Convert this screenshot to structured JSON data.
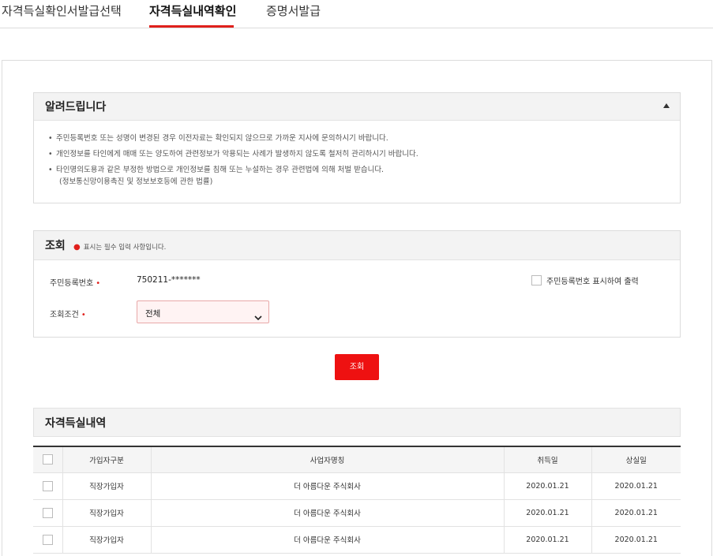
{
  "tabs": [
    {
      "label": "자격득실확인서발급선택"
    },
    {
      "label": "자격득실내역확인"
    },
    {
      "label": "증명서발급"
    }
  ],
  "colors": {
    "accent": "#e0201c",
    "button": "#ee1111",
    "panel_bg": "#f3f3f3"
  },
  "notice": {
    "title": "알려드립니다",
    "collapse_icon": "triangle-up-icon",
    "items": [
      "주민등록번호 또는 성명이 변경된 경우 이전자료는 확인되지 않으므로 가까운 지사에 문의하시기 바랍니다.",
      "개인정보를 타인에게 매매 또는 양도하여 관련정보가 악용되는 사례가 발생하지 않도록 철저히 관리하시기 바랍니다.",
      "타인명의도용과 같은 부정한 방법으로 개인정보를 침해 또는 누설하는 경우 관련법에 의해 처벌 받습니다."
    ],
    "item3_sub": "(정보통신망이용촉진 및 정보보호등에 관한 법률)"
  },
  "search": {
    "title": "조회",
    "required_note": "표시는 필수 입력 사항입니다.",
    "rrn_label": "주민등록번호",
    "rrn_value": "750211-*******",
    "show_rrn_label": "주민등록번호 표시하여 출력",
    "condition_label": "조회조건",
    "condition_value": "전체",
    "button_label": "조회"
  },
  "results": {
    "title": "자격득실내역",
    "columns": [
      "가입자구분",
      "사업자명칭",
      "취득일",
      "상실일"
    ],
    "rows": [
      {
        "type": "직장가입자",
        "company": "더 아름다운 주식회사",
        "acquired": "2020.01.21",
        "lost": "2020.01.21"
      },
      {
        "type": "직장가입자",
        "company": "더 아름다운 주식회사",
        "acquired": "2020.01.21",
        "lost": "2020.01.21"
      },
      {
        "type": "직장가입자",
        "company": "더 아름다운 주식회사",
        "acquired": "2020.01.21",
        "lost": "2020.01.21"
      }
    ]
  }
}
